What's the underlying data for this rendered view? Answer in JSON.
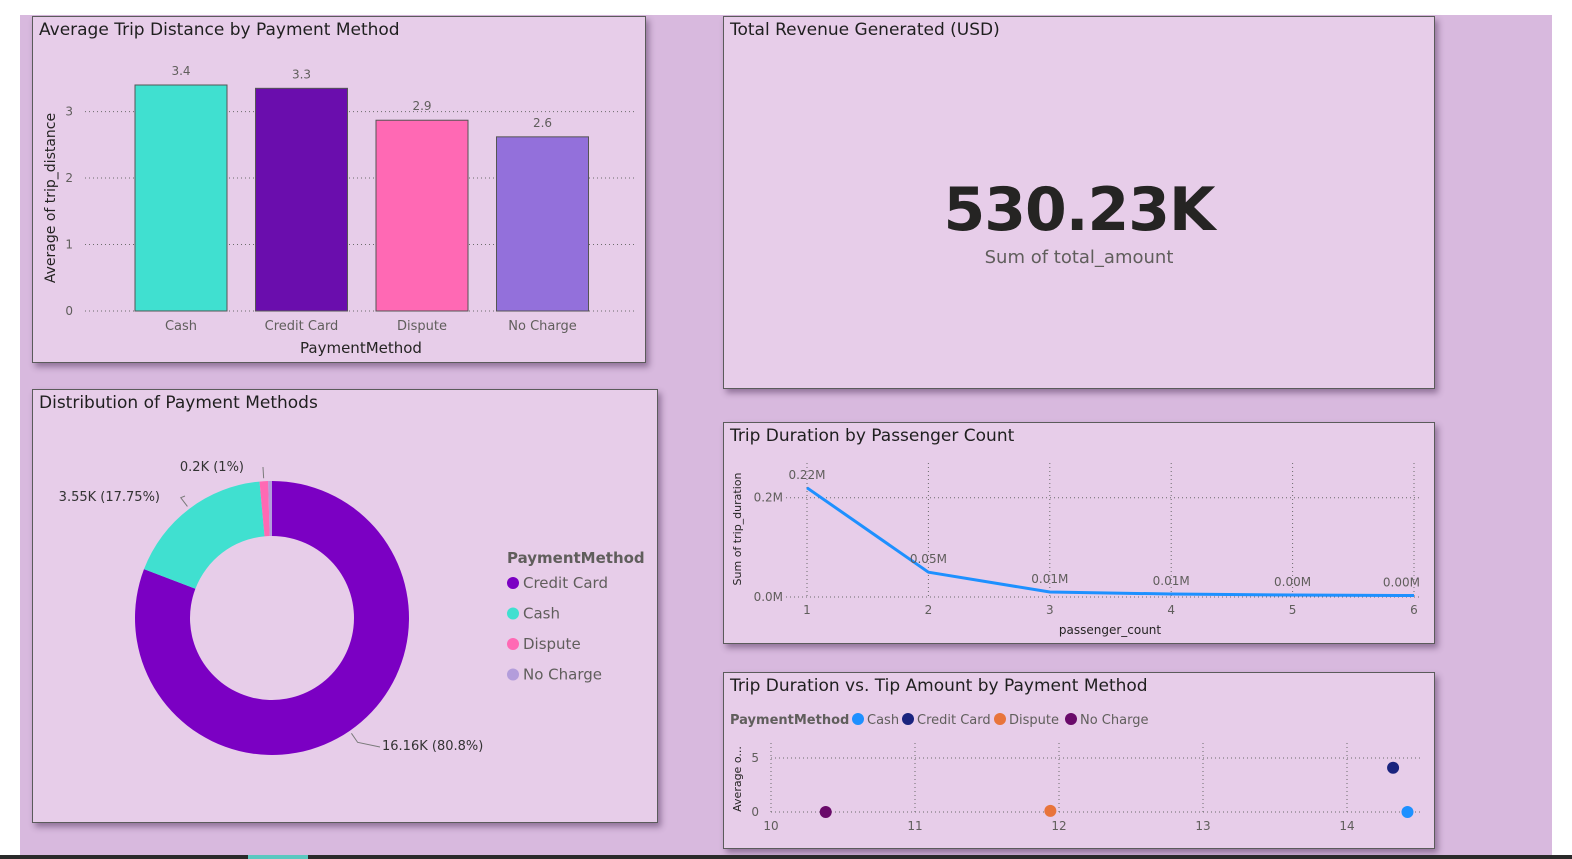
{
  "cards": {
    "bar": {
      "title": "Average Trip Distance by Payment Method"
    },
    "kpi": {
      "title": "Total Revenue Generated (USD)",
      "value": "530.23K",
      "subtitle": "Sum of total_amount"
    },
    "donut": {
      "title": "Distribution of Payment Methods"
    },
    "line": {
      "title": "Trip Duration by Passenger Count"
    },
    "scatter": {
      "title": "Trip Duration vs. Tip Amount by Payment Method"
    }
  },
  "chart_data": [
    {
      "id": "bar",
      "type": "bar",
      "categories": [
        "Cash",
        "Credit Card",
        "Dispute",
        "No Charge"
      ],
      "values": [
        3.4,
        3.35,
        2.87,
        2.62
      ],
      "labels": [
        "3.4",
        "3.3",
        "2.9",
        "2.6"
      ],
      "colors": [
        "#40e0d0",
        "#6a0dad",
        "#ff69b4",
        "#9370db"
      ],
      "xlabel": "PaymentMethod",
      "ylabel": "Average of trip_distance",
      "ylim": [
        0,
        3.4
      ],
      "yticks": [
        0,
        1,
        2,
        3
      ],
      "grid": true
    },
    {
      "id": "donut",
      "type": "pie",
      "legend_title": "PaymentMethod",
      "legend_placement": "right",
      "slices": [
        {
          "name": "Credit Card",
          "value": 80.8,
          "label": "16.16K (80.8%)",
          "color": "#7b00c3"
        },
        {
          "name": "Cash",
          "value": 17.75,
          "label": "3.55K (17.75%)",
          "color": "#40e0d0"
        },
        {
          "name": "Dispute",
          "value": 1.0,
          "label": "0.2K (1%)",
          "color": "#ff69b4"
        },
        {
          "name": "No Charge",
          "value": 0.45,
          "label": "",
          "color": "#b39ddb"
        }
      ]
    },
    {
      "id": "line",
      "type": "line",
      "x": [
        1,
        2,
        3,
        4,
        5,
        6
      ],
      "y": [
        0.22,
        0.05,
        0.01,
        0.006,
        0.004,
        0.003
      ],
      "labels": [
        "0.22M",
        "0.05M",
        "0.01M",
        "0.01M",
        "0.00M",
        "0.00M"
      ],
      "xlabel": "passenger_count",
      "ylabel": "Sum of trip_duration",
      "yticks": [
        "0.0M",
        "0.2M"
      ],
      "ytick_values": [
        0,
        0.2
      ],
      "ylim": [
        0,
        0.27
      ],
      "color": "#1e90ff",
      "grid": true
    },
    {
      "id": "scatter",
      "type": "scatter",
      "legend_title": "PaymentMethod",
      "legend_placement": "top-left",
      "ylabel": "Average o...",
      "xlim": [
        10,
        14.5
      ],
      "ylim": [
        0,
        5
      ],
      "xticks": [
        10,
        11,
        12,
        13,
        14
      ],
      "yticks": [
        0,
        5
      ],
      "series": [
        {
          "name": "Cash",
          "color": "#1e90ff",
          "points": [
            [
              14.42,
              0
            ]
          ]
        },
        {
          "name": "Credit Card",
          "color": "#1a237e",
          "points": [
            [
              14.32,
              4.1
            ]
          ]
        },
        {
          "name": "Dispute",
          "color": "#e8743b",
          "points": [
            [
              11.94,
              0.1
            ]
          ]
        },
        {
          "name": "No Charge",
          "color": "#6a0a6a",
          "points": [
            [
              10.38,
              0
            ]
          ]
        }
      ],
      "grid": true
    }
  ]
}
